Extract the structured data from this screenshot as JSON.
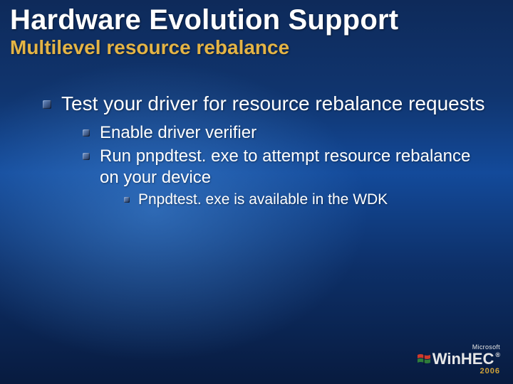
{
  "title": "Hardware Evolution Support",
  "subtitle": "Multilevel resource rebalance",
  "bullets": {
    "lvl1_0": "Test your driver for resource rebalance requests",
    "lvl2_0": "Enable driver verifier",
    "lvl2_1": "Run pnpdtest. exe to attempt resource rebalance on your device",
    "lvl3_0": "Pnpdtest. exe is available in the WDK"
  },
  "logo": {
    "company": "Microsoft",
    "brand": "WinHEC",
    "year": "2006"
  }
}
